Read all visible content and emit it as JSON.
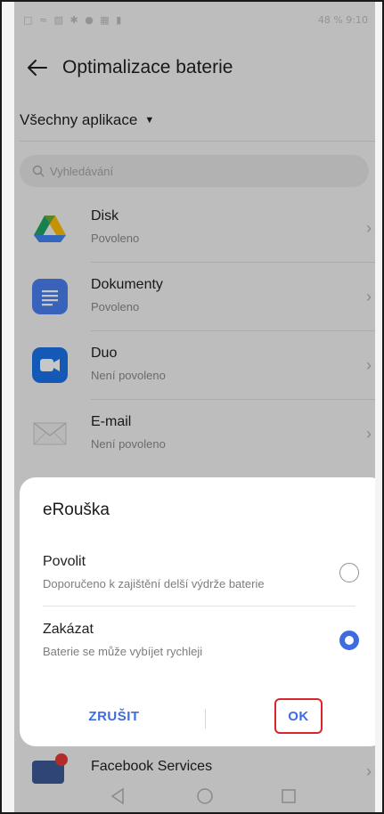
{
  "status_bar": {
    "left_icons": "□ ≈ ▧ ✱ ● ▦ ▮",
    "battery": "48 %",
    "time": "9:10"
  },
  "header": {
    "title": "Optimalizace baterie"
  },
  "filter": {
    "label": "Všechny aplikace"
  },
  "search": {
    "placeholder": "Vyhledávání"
  },
  "apps": [
    {
      "name": "Disk",
      "status": "Povoleno",
      "icon": "google-drive-icon"
    },
    {
      "name": "Dokumenty",
      "status": "Povoleno",
      "icon": "google-docs-icon"
    },
    {
      "name": "Duo",
      "status": "Není povoleno",
      "icon": "google-duo-icon"
    },
    {
      "name": "E-mail",
      "status": "Není povoleno",
      "icon": "email-envelope-icon"
    }
  ],
  "dialog": {
    "title": "eRouška",
    "options": [
      {
        "title": "Povolit",
        "subtitle": "Doporučeno k zajištění delší výdrže baterie",
        "selected": false
      },
      {
        "title": "Zakázat",
        "subtitle": "Baterie se může vybíjet rychleji",
        "selected": true
      }
    ],
    "cancel_label": "ZRUŠIT",
    "ok_label": "OK"
  },
  "peek_app": {
    "name": "Facebook Services",
    "icon": "facebook-services-icon"
  },
  "colors": {
    "accent": "#3e6be0",
    "highlight_border": "#d9262c"
  }
}
